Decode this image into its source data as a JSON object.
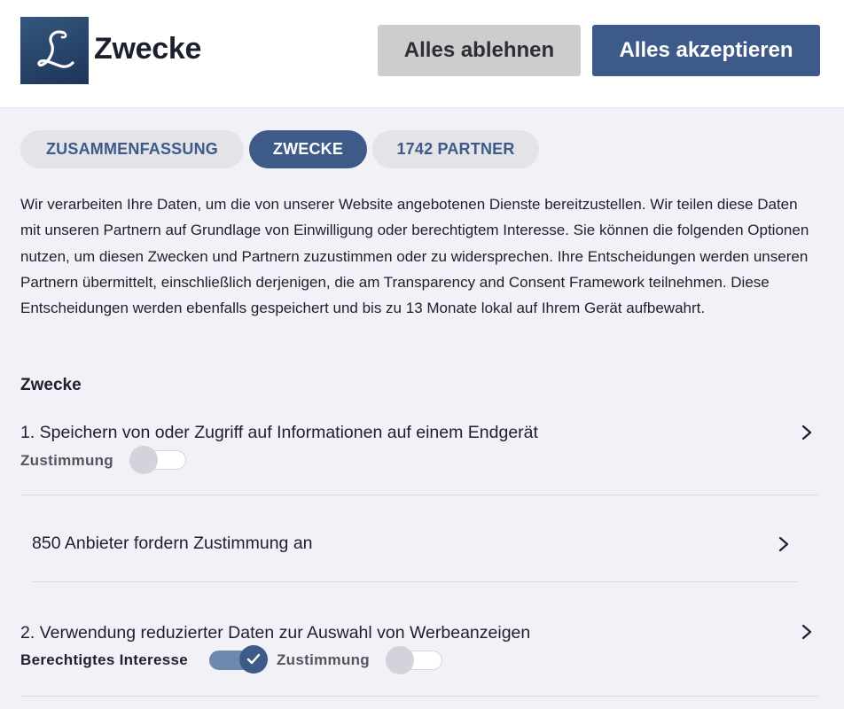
{
  "header": {
    "title": "Zwecke",
    "reject_label": "Alles ablehnen",
    "accept_label": "Alles akzeptieren"
  },
  "tabs": [
    {
      "label": "ZUSAMMENFASSUNG",
      "active": false
    },
    {
      "label": "ZWECKE",
      "active": true
    },
    {
      "label": "1742 PARTNER",
      "active": false
    }
  ],
  "description": "Wir verarbeiten Ihre Daten, um die von unserer Website angebotenen Dienste bereitzustellen. Wir teilen diese Daten mit unseren Partnern auf Grundlage von Einwilligung oder berechtigtem Interesse. Sie können die folgenden Optionen nutzen, um diesen Zwecken und Partnern zuzustimmen oder zu widersprechen. Ihre Entscheidungen werden unseren Partnern übermittelt, einschließlich derjenigen, die am Transparency and Consent Framework teilnehmen. Diese Entscheidungen werden ebenfalls gespeichert und bis zu 13 Monate lokal auf Ihrem Gerät aufbewahrt.",
  "section_title": "Zwecke",
  "purposes": [
    {
      "title": "1. Speichern von oder Zugriff auf Informationen auf einem Endgerät",
      "consent_label": "Zustimmung",
      "consent_on": false
    },
    {
      "title": "2. Verwendung reduzierter Daten zur Auswahl von Werbeanzeigen",
      "legit_label": "Berechtigtes Interesse",
      "legit_on": true,
      "consent_label": "Zustimmung",
      "consent_on": false
    }
  ],
  "vendor_row": "850 Anbieter fordern Zustimmung an",
  "colors": {
    "primary": "#3d5a88",
    "secondary_button": "#cdcdcd",
    "background": "#f1f1f7"
  }
}
